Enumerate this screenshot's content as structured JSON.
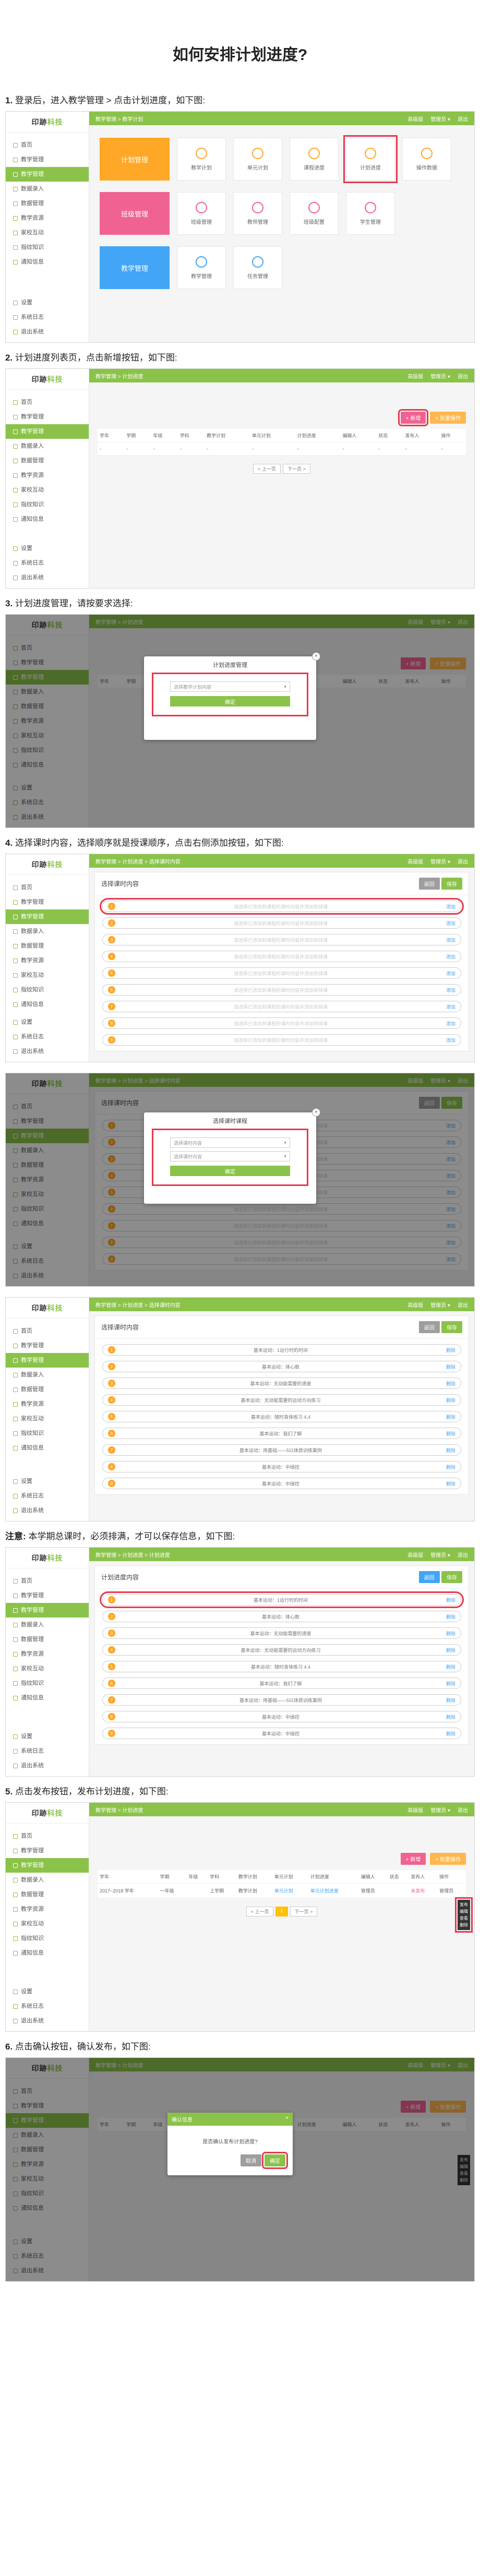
{
  "title": "如何安排计划进度?",
  "app": {
    "logo_a": "印跡",
    "logo_b": "科技",
    "nav": [
      "首页",
      "教学管理",
      "教学管理",
      "数据录入",
      "数据管理",
      "教学资源",
      "家校互动",
      "指纹知识",
      "通知信息"
    ],
    "nav_bottom": [
      "设置",
      "系统日志",
      "退出系统"
    ],
    "top_links": [
      "高级版",
      "管理员 ▾",
      "退出"
    ]
  },
  "steps": [
    {
      "num": "1.",
      "text": "登录后，进入教学管理 > 点击计划进度，如下图:"
    },
    {
      "num": "2.",
      "text": "计划进度列表页，点击新增按钮，如下图:"
    },
    {
      "num": "3.",
      "text": "计划进度管理，请按要求选择:"
    },
    {
      "num": "4.",
      "text": "选择课时内容，选择顺序就是授课顺序，点击右侧添加按钮，如下图:"
    },
    {
      "num": "5.",
      "text": "点击发布按钮，发布计划进度，如下图:"
    },
    {
      "num": "6.",
      "text": "点击确认按钮，确认发布，如下图:"
    }
  ],
  "note": {
    "label": "注意:",
    "text": "本学期总课时，必须排满，才可以保存信息，如下图:"
  },
  "s1": {
    "crumb": "教学管理 > 教学计划",
    "row1_big": "计划管理",
    "row1": [
      "教学计划",
      "单元计划",
      "课程进度",
      "计划进度",
      "操作数据"
    ],
    "row2_big": "班级管理",
    "row2": [
      "班级管理",
      "教师管理",
      "班级配置",
      "学生管理"
    ],
    "row3_big": "教学管理",
    "row3": [
      "教学管理",
      "任务管理"
    ],
    "colors": {
      "orange": "#ffa726",
      "pink": "#f06292",
      "blue": "#42a5f5"
    }
  },
  "s2": {
    "crumb": "教学管理 > 计划进度",
    "add_btn": "+ 新增",
    "other_btn": "+ 批量操作",
    "headers": [
      "学年",
      "学期",
      "年级",
      "学科",
      "教学计划",
      "单元计划",
      "计划进度",
      "编辑人",
      "状态",
      "发布人",
      "操作"
    ],
    "empty_row": [
      "-",
      "-",
      "-",
      "-",
      "-",
      "-",
      "-",
      "-",
      "-",
      "-",
      "-"
    ],
    "pager": [
      "< 上一页",
      "下一页 >"
    ]
  },
  "s3": {
    "modal_title": "计划进度管理",
    "select_ph": "选择教学计划内容",
    "confirm": "确定"
  },
  "s4": {
    "crumb": "教学管理 > 计划进度 > 选择课时内容",
    "panel_title": "选择课时内容",
    "btn_back": "返回",
    "btn_save": "保存",
    "placeholder": "请选择已添加到课程的课时内容并添加到排课",
    "action": "添加",
    "count": 9
  },
  "s4b": {
    "modal_title": "选择课时课程",
    "select1": "选择课时内容",
    "select2": "选择课时内容",
    "confirm": "确定"
  },
  "s4c": {
    "crumb": "教学管理 > 计划进度 > 选择课时内容",
    "panel_title": "选择课时内容",
    "lessons": [
      "基本运动：1运行时的时间",
      "基本运动：体心数",
      "基本运动：无动能需要的速度",
      "基本运动：无动能需要的运动方向练习",
      "基本运动：随时身体练习 4.4",
      "基本运动：我们了解",
      "基本运动：用基础——5以体质训练案例",
      "基本运动：中操控",
      "基本运动：中操控"
    ],
    "action": "删除"
  },
  "s_note": {
    "crumb": "教学管理 > 计划进度 > 计划进度",
    "panel_title": "计划进度内容",
    "btn_a": "返回",
    "btn_b": "保存",
    "lessons": [
      "基本运动：1运行时的时间",
      "基本运动：体心数",
      "基本运动：无动能需要的速度",
      "基本运动：无动能需要的运动方向练习",
      "基本运动：随时身体练习 4.4",
      "基本运动：我们了解",
      "基本运动：用基础——5以体质训练案例",
      "基本运动：中操控",
      "基本运动：中操控"
    ]
  },
  "s5": {
    "crumb": "教学管理 > 计划进度",
    "row": [
      "2017~2018 学年",
      "一年级",
      "",
      "上学期",
      "教学计划",
      "单元计划",
      "单元计划进度",
      "管理员",
      "",
      "未发布",
      "管理员"
    ],
    "pager": [
      "< 上一页",
      "1",
      "下一页 >"
    ],
    "menu": [
      "发布",
      "编辑",
      "查看",
      "删除"
    ]
  },
  "s6": {
    "dialog_title": "确认信息",
    "dialog_text": "是否确认发布计划进度?",
    "cancel": "取消",
    "ok": "确定"
  }
}
